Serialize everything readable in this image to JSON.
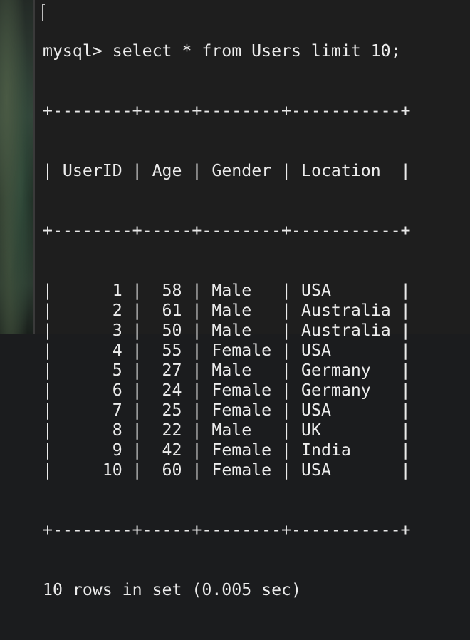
{
  "prompt": "mysql> ",
  "command": "select * from Users limit 10;",
  "table": {
    "columns": [
      "UserID",
      "Age",
      "Gender",
      "Location"
    ],
    "rows": [
      [
        "1",
        "58",
        "Male",
        "USA"
      ],
      [
        "2",
        "61",
        "Male",
        "Australia"
      ],
      [
        "3",
        "50",
        "Male",
        "Australia"
      ],
      [
        "4",
        "55",
        "Female",
        "USA"
      ],
      [
        "5",
        "27",
        "Male",
        "Germany"
      ],
      [
        "6",
        "24",
        "Female",
        "Germany"
      ],
      [
        "7",
        "25",
        "Female",
        "USA"
      ],
      [
        "8",
        "22",
        "Male",
        "UK"
      ],
      [
        "9",
        "42",
        "Female",
        "India"
      ],
      [
        "10",
        "60",
        "Female",
        "USA"
      ]
    ]
  },
  "status": "10 rows in set (0.005 sec)",
  "colors": {
    "terminal_bg": "#1e1e1e",
    "text": "#ececec"
  }
}
